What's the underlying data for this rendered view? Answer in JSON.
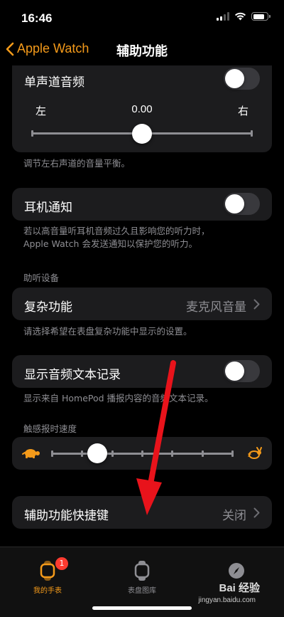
{
  "status": {
    "time": "16:46"
  },
  "nav": {
    "back_label": "Apple Watch",
    "title": "辅助功能"
  },
  "mono_audio": {
    "label": "单声道音频",
    "left_label": "左",
    "right_label": "右",
    "balance_value": "0.00",
    "footnote": "调节左右声道的音量平衡。"
  },
  "headphone_notify": {
    "label": "耳机通知",
    "footnote_line1": "若以高音量听耳机音频过久且影响您的听力时，",
    "footnote_line2": "Apple Watch 会发送通知以保护您的听力。"
  },
  "hearing_section": {
    "header": "助听设备"
  },
  "complication": {
    "label": "复杂功能",
    "value": "麦克风音量",
    "footnote": "请选择希望在表盘复杂功能中显示的设置。"
  },
  "transcription": {
    "label": "显示音频文本记录",
    "footnote": "显示来自 HomePod 播报内容的音频文本记录。"
  },
  "haptic_speed": {
    "header": "触感报时速度",
    "level": 0.25
  },
  "shortcut": {
    "label": "辅助功能快捷键",
    "value": "关闭"
  },
  "tabbar": {
    "my_watch": "我的手表",
    "badge": "1",
    "face_gallery": "表盘图库",
    "discover": "发现"
  },
  "watermark": {
    "text": "Bai 经验",
    "sub": "jingyan.baidu.com"
  },
  "colors": {
    "accent": "#f49a1a",
    "arrow": "#e8131b"
  }
}
